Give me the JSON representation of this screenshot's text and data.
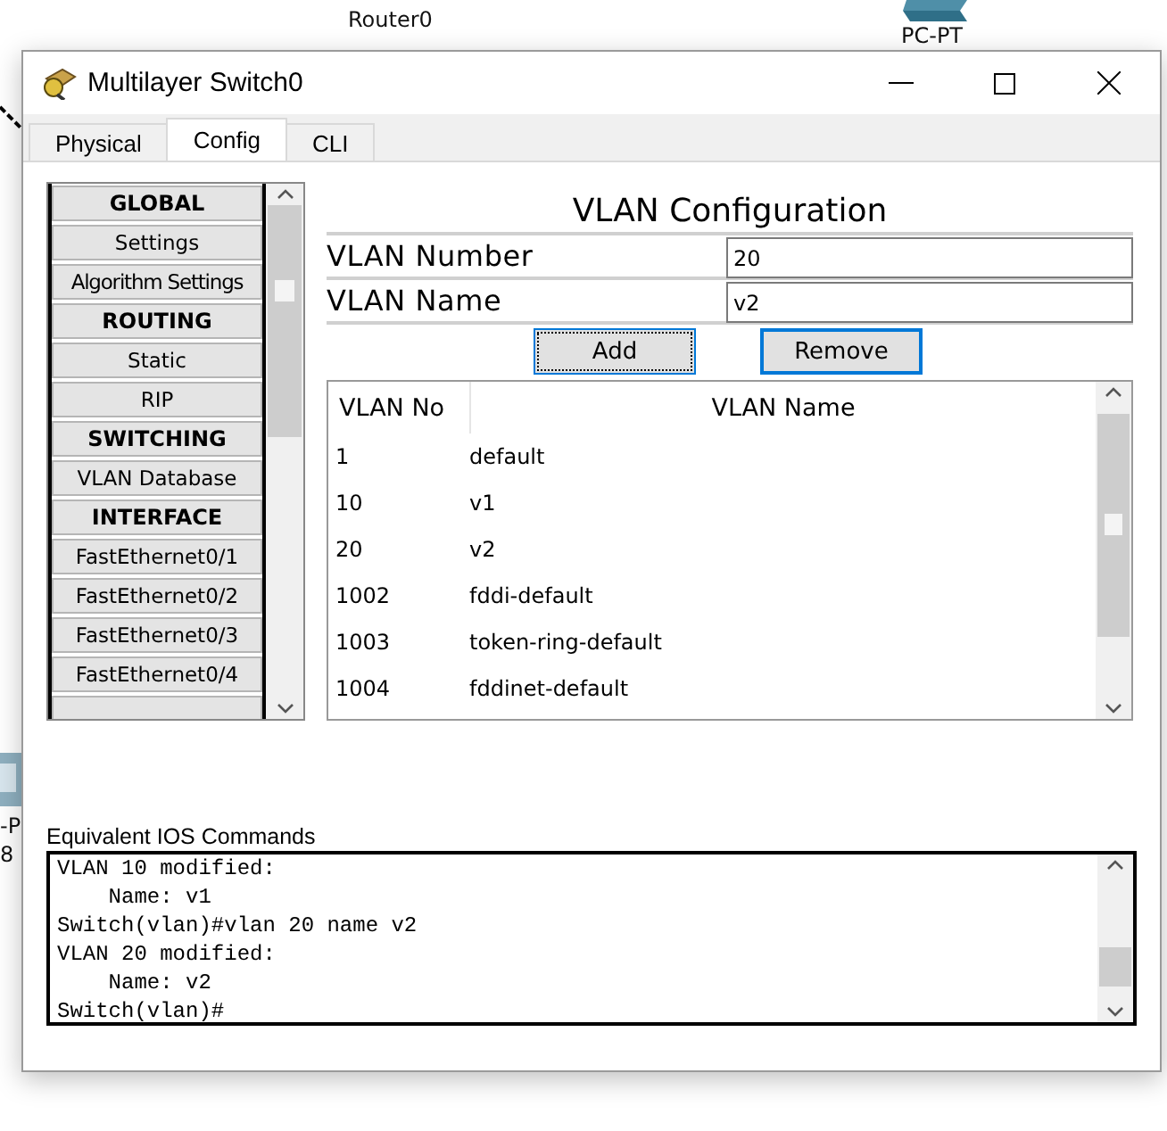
{
  "canvas_labels": [
    {
      "text": "Router0",
      "kind": "label"
    },
    {
      "text": "PC-PT",
      "kind": "device"
    },
    {
      "text": "-P",
      "kind": "edge"
    },
    {
      "text": "8",
      "kind": "edge"
    }
  ],
  "window": {
    "title": "Multilayer Switch0"
  },
  "tabs": [
    {
      "label": "Physical",
      "selected": false
    },
    {
      "label": "Config",
      "selected": true
    },
    {
      "label": "CLI",
      "selected": false
    }
  ],
  "sidebar": {
    "items": [
      {
        "label": "GLOBAL",
        "kind": "header"
      },
      {
        "label": "Settings",
        "kind": "item"
      },
      {
        "label": "Algorithm Settings",
        "kind": "item"
      },
      {
        "label": "ROUTING",
        "kind": "header"
      },
      {
        "label": "Static",
        "kind": "item"
      },
      {
        "label": "RIP",
        "kind": "item"
      },
      {
        "label": "SWITCHING",
        "kind": "header"
      },
      {
        "label": "VLAN Database",
        "kind": "item"
      },
      {
        "label": "INTERFACE",
        "kind": "header"
      },
      {
        "label": "FastEthernet0/1",
        "kind": "item"
      },
      {
        "label": "FastEthernet0/2",
        "kind": "item"
      },
      {
        "label": "FastEthernet0/3",
        "kind": "item"
      },
      {
        "label": "FastEthernet0/4",
        "kind": "item"
      }
    ]
  },
  "panel": {
    "title": "VLAN Configuration",
    "fields": [
      {
        "label": "VLAN Number",
        "value": "20"
      },
      {
        "label": "VLAN Name",
        "value": "v2"
      }
    ],
    "buttons": [
      {
        "label": "Add",
        "focused": true,
        "hovered": false
      },
      {
        "label": "Remove",
        "focused": false,
        "hovered": true
      }
    ],
    "table": {
      "columns": [
        "VLAN No",
        "VLAN Name"
      ],
      "rows": [
        [
          "1",
          "default"
        ],
        [
          "10",
          "v1"
        ],
        [
          "20",
          "v2"
        ],
        [
          "1002",
          "fddi-default"
        ],
        [
          "1003",
          "token-ring-default"
        ],
        [
          "1004",
          "fddinet-default"
        ]
      ]
    }
  },
  "ios": {
    "label": "Equivalent IOS Commands",
    "lines": [
      "VLAN 10 modified:",
      "    Name: v1",
      "Switch(vlan)#vlan 20 name v2",
      "VLAN 20 modified:",
      "    Name: v2",
      "Switch(vlan)#"
    ]
  }
}
